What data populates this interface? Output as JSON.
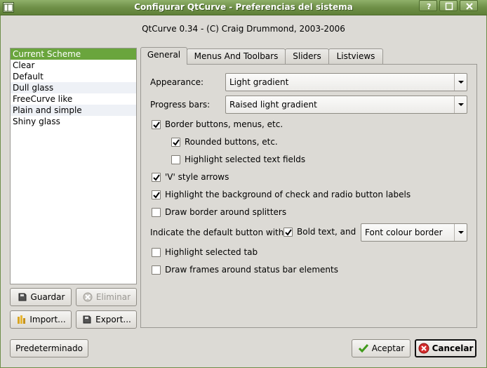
{
  "window": {
    "title": "Configurar QtCurve - Preferencias del sistema"
  },
  "header": {
    "text": "QtCurve 0.34 - (C) Craig Drummond, 2003-2006"
  },
  "schemes": [
    "Current Scheme",
    "Clear",
    "Default",
    "Dull glass",
    "FreeCurve like",
    "Plain and simple",
    "Shiny glass"
  ],
  "scheme_buttons": {
    "save": "Guardar",
    "delete": "Eliminar",
    "import": "Import...",
    "export": "Export..."
  },
  "tabs": [
    "General",
    "Menus And Toolbars",
    "Sliders",
    "Listviews"
  ],
  "general": {
    "appearance_label": "Appearance:",
    "appearance_value": "Light gradient",
    "progress_label": "Progress bars:",
    "progress_value": "Raised light gradient",
    "border_buttons": "Border buttons, menus, etc.",
    "rounded_buttons": "Rounded buttons, etc.",
    "highlight_text_fields": "Highlight selected text fields",
    "v_arrows": "'V' style arrows",
    "highlight_bg_labels": "Highlight the background of check and radio button labels",
    "border_splitters": "Draw border around splitters",
    "default_button_label": "Indicate the default button with:",
    "bold_text": "Bold text, and",
    "default_button_value": "Font colour border",
    "highlight_tab": "Highlight selected tab",
    "status_frames": "Draw frames around status bar elements"
  },
  "footer": {
    "defaults": "Predeterminado",
    "accept": "Aceptar",
    "cancel": "Cancelar"
  },
  "colors": {
    "accent": "#6aa53d",
    "titlebar": "#6f9048"
  }
}
